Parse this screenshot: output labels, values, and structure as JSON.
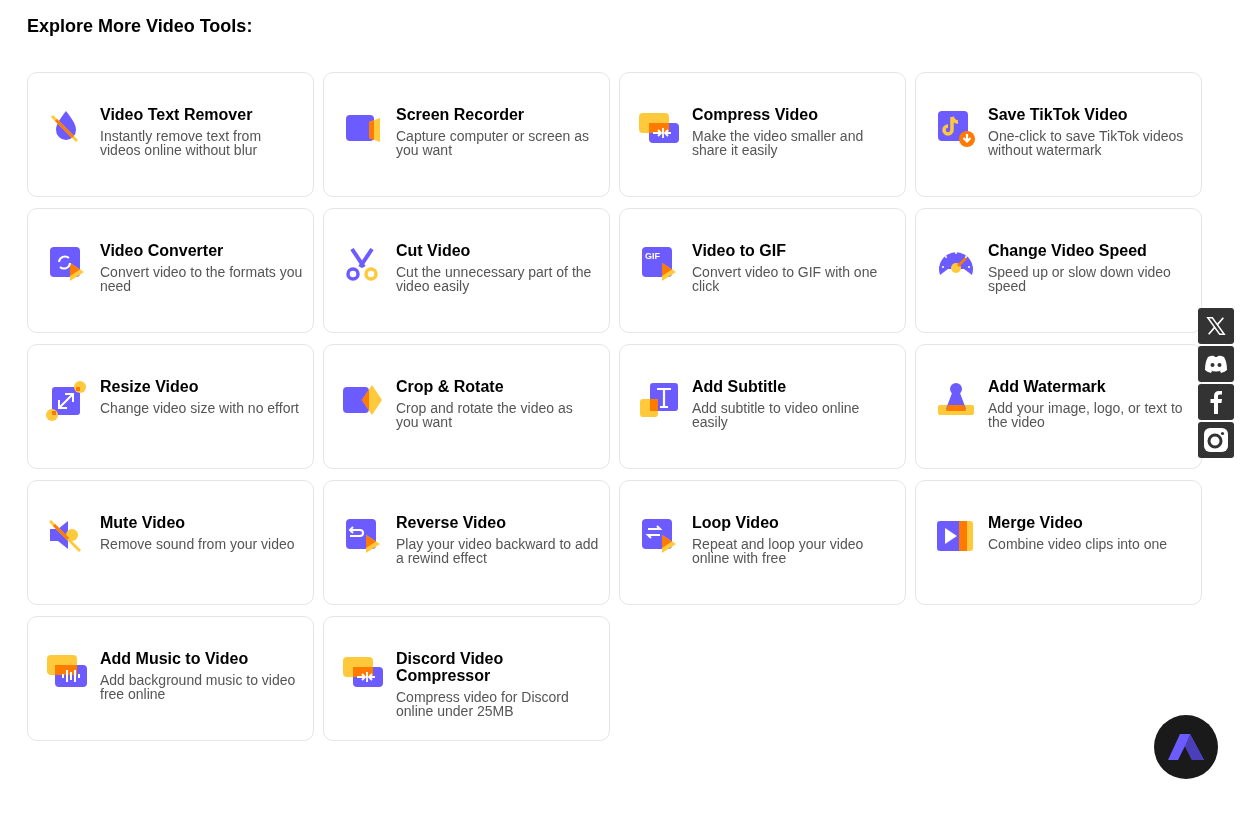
{
  "heading": "Explore More Video Tools:",
  "tools": [
    {
      "title": "Video Text Remover",
      "description": "Instantly remove text from videos online without blur"
    },
    {
      "title": "Screen Recorder",
      "description": "Capture computer or screen as you want"
    },
    {
      "title": "Compress Video",
      "description": "Make the video smaller and share it easily"
    },
    {
      "title": "Save TikTok Video",
      "description": "One-click to save TikTok videos without watermark"
    },
    {
      "title": "Video Converter",
      "description": "Convert video to the formats you need"
    },
    {
      "title": "Cut Video",
      "description": "Cut the unnecessary part of the video easily"
    },
    {
      "title": "Video to GIF",
      "description": "Convert video to GIF with one click",
      "icon_label": "GIF"
    },
    {
      "title": "Change Video Speed",
      "description": "Speed up or slow down video speed"
    },
    {
      "title": "Resize Video",
      "description": "Change video size with no effort"
    },
    {
      "title": "Crop & Rotate",
      "description": "Crop and rotate the video as you want"
    },
    {
      "title": "Add Subtitle",
      "description": "Add subtitle to video online easily"
    },
    {
      "title": "Add Watermark",
      "description": "Add your image, logo, or text to the video"
    },
    {
      "title": "Mute Video",
      "description": "Remove sound from your video"
    },
    {
      "title": "Reverse Video",
      "description": "Play your video backward to add a rewind effect"
    },
    {
      "title": "Loop Video",
      "description": "Repeat and loop your video online with free"
    },
    {
      "title": "Merge Video",
      "description": "Combine video clips into one"
    },
    {
      "title": "Add Music to Video",
      "description": "Add background music to video free online"
    },
    {
      "title": "Discord Video Compressor",
      "description": "Compress video for Discord online under 25MB"
    }
  ]
}
